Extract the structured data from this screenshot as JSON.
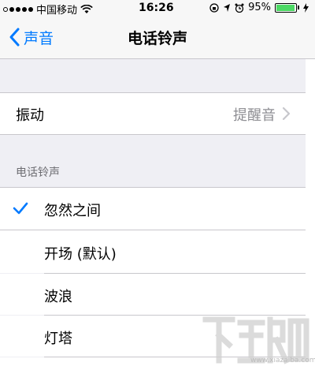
{
  "status_bar": {
    "carrier": "中国移动",
    "time": "16:26",
    "battery": "95%",
    "battery_level": 0.95,
    "signal_icon": "signal-dots-icon",
    "wifi_icon": "wifi-icon",
    "lock_icon": "rotation-lock-icon",
    "location_icon": "location-arrow-icon",
    "alarm_icon": "alarm-clock-icon",
    "charging_icon": "charging-bolt-icon"
  },
  "nav": {
    "back_label": "声音",
    "title": "电话铃声"
  },
  "vibration_row": {
    "label": "振动",
    "value": "提醒音"
  },
  "section": {
    "header": "电话铃声"
  },
  "ringtones": [
    {
      "label": "忽然之间",
      "selected": true
    },
    {
      "label": "开场 (默认)",
      "selected": false
    },
    {
      "label": "波浪",
      "selected": false
    },
    {
      "label": "灯塔",
      "selected": false
    }
  ],
  "watermark": {
    "url": "www.xiazaiba.com"
  },
  "colors": {
    "accent": "#007aff",
    "background": "#efeff4",
    "battery": "#4cd964"
  }
}
